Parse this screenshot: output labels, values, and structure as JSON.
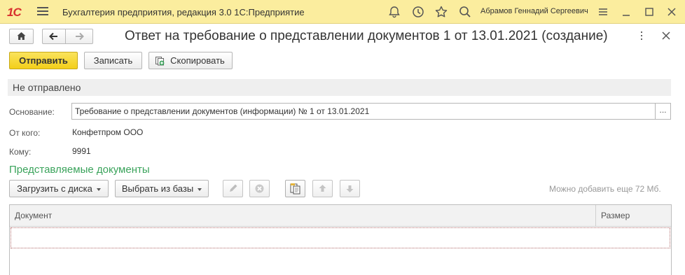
{
  "titlebar": {
    "logo": "1С",
    "app_title": "Бухгалтерия предприятия, редакция 3.0 1С:Предприятие",
    "user": "Абрамов Геннадий Сергеевич"
  },
  "form": {
    "title": "Ответ на требование о представлении документов 1 от 13.01.2021 (создание)"
  },
  "commands": {
    "send": "Отправить",
    "save": "Записать",
    "copy": "Скопировать"
  },
  "status": "Не отправлено",
  "fields": {
    "basis_label": "Основание:",
    "basis_value": "Требование о представлении документов (информации) № 1 от 13.01.2021",
    "basis_select": "...",
    "from_label": "От кого:",
    "from_value": "Конфетпром ООО",
    "to_label": "Кому:",
    "to_value": "9991"
  },
  "documents": {
    "section_title": "Представляемые документы",
    "load_from_disk": "Загрузить с диска",
    "select_from_db": "Выбрать из базы",
    "size_hint": "Можно добавить еще 72 Мб.",
    "columns": [
      "Документ",
      "Размер"
    ],
    "rows": []
  },
  "colors": {
    "titlebar_bg": "#fbed9e",
    "primary_button": "#f3cf1a",
    "section_title": "#3aa35b",
    "logo": "#d8302f"
  }
}
